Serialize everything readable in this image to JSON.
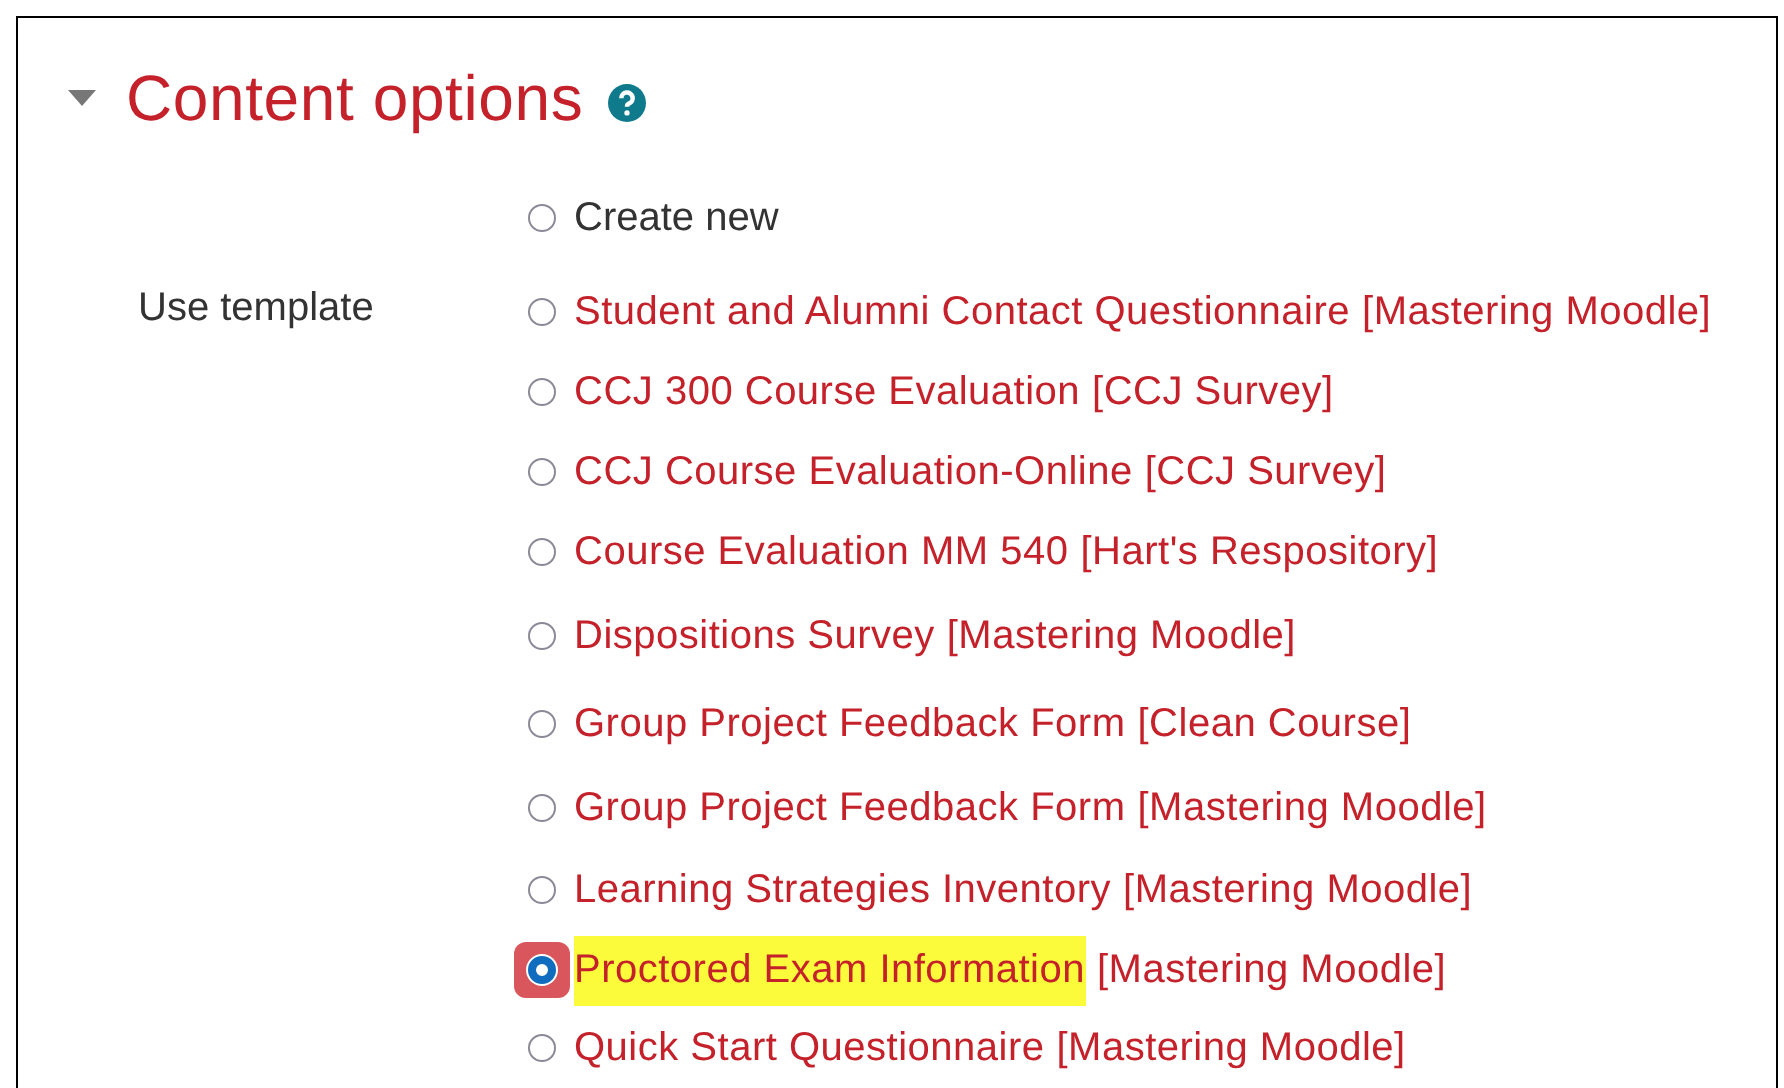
{
  "section": {
    "title": "Content options",
    "expanded": true
  },
  "create_option": {
    "label": "Create new",
    "selected": false
  },
  "template_label": "Use template",
  "templates": [
    {
      "title": "Student and Alumni Contact Questionnaire",
      "source": "[Mastering Moodle]",
      "selected": false,
      "highlighted": false
    },
    {
      "title": "CCJ 300 Course Evaluation",
      "source": "[CCJ Survey]",
      "selected": false,
      "highlighted": false
    },
    {
      "title": "CCJ Course Evaluation-Online",
      "source": "[CCJ Survey]",
      "selected": false,
      "highlighted": false
    },
    {
      "title": "Course Evaluation MM 540",
      "source": "[Hart's Respository]",
      "selected": false,
      "highlighted": false
    },
    {
      "title": "Dispositions Survey",
      "source": "[Mastering Moodle]",
      "selected": false,
      "highlighted": false
    },
    {
      "title": "Group Project Feedback Form",
      "source": "[Clean Course]",
      "selected": false,
      "highlighted": false
    },
    {
      "title": "Group Project Feedback Form",
      "source": "[Mastering Moodle]",
      "selected": false,
      "highlighted": false
    },
    {
      "title": "Learning Strategies Inventory",
      "source": "[Mastering Moodle]",
      "selected": false,
      "highlighted": false
    },
    {
      "title": "Proctored Exam Information",
      "source": "[Mastering Moodle]",
      "selected": true,
      "highlighted": true
    },
    {
      "title": "Quick Start Questionnaire",
      "source": "[Mastering Moodle]",
      "selected": false,
      "highlighted": false
    }
  ]
}
